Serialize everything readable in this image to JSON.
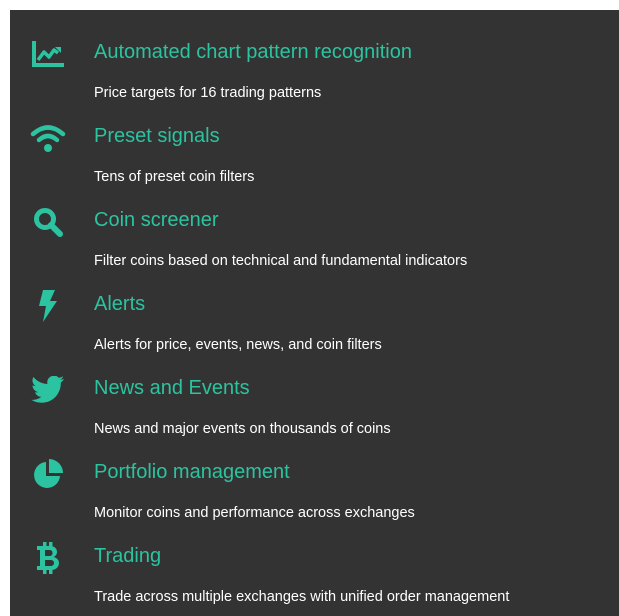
{
  "colors": {
    "background": "#333333",
    "accent": "#2bc3a0",
    "text": "#ffffff"
  },
  "features": [
    {
      "icon": "line-chart-icon",
      "title": "Automated chart pattern recognition",
      "description": "Price targets for 16 trading patterns"
    },
    {
      "icon": "wifi-signal-icon",
      "title": "Preset signals",
      "description": "Tens of preset coin filters"
    },
    {
      "icon": "search-icon",
      "title": "Coin screener",
      "description": "Filter coins based on technical and fundamental indicators"
    },
    {
      "icon": "lightning-bolt-icon",
      "title": "Alerts",
      "description": "Alerts for price, events, news, and coin filters"
    },
    {
      "icon": "twitter-bird-icon",
      "title": "News and Events",
      "description": "News and major events on thousands of coins"
    },
    {
      "icon": "pie-chart-icon",
      "title": "Portfolio management",
      "description": "Monitor coins and performance across exchanges"
    },
    {
      "icon": "bitcoin-icon",
      "title": "Trading",
      "description": "Trade across multiple exchanges with unified order management"
    }
  ]
}
